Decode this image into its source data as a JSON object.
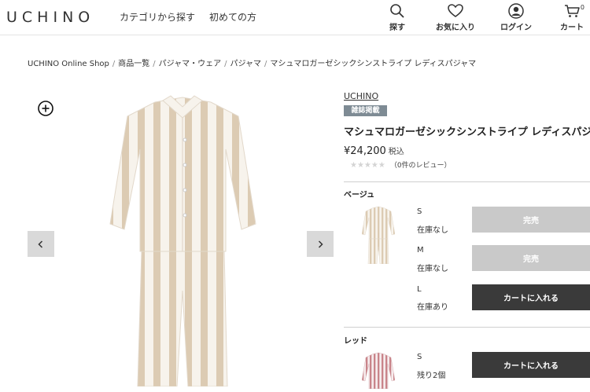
{
  "header": {
    "logo": "UCHINO",
    "nav": [
      "カテゴリから探す",
      "初めての方"
    ],
    "icons": [
      {
        "icon": "search-icon",
        "label": "探す"
      },
      {
        "icon": "heart-icon",
        "label": "お気に入り"
      },
      {
        "icon": "user-icon",
        "label": "ログイン"
      },
      {
        "icon": "cart-icon",
        "label": "カート",
        "count": "0"
      }
    ]
  },
  "breadcrumb": [
    "UCHINO Online Shop",
    "商品一覧",
    "パジャマ・ウェア",
    "パジャマ",
    "マシュマロガーゼシックシンストライプ レディスパジャマ"
  ],
  "product": {
    "brand": "UCHINO",
    "badge": "雑誌掲載",
    "title": "マシュマロガーゼシックシンストライプ レディスパジャマ",
    "price": "¥24,200",
    "tax_label": "税込",
    "stars": "★★★★★",
    "review_text": "（0件のレビュー）"
  },
  "colors": [
    {
      "name": "ベージュ",
      "stripe_color": "#d8c7ae",
      "sizes": [
        {
          "size": "S",
          "stock": "在庫なし",
          "button": "完売",
          "state": "soldout"
        },
        {
          "size": "M",
          "stock": "在庫なし",
          "button": "完売",
          "state": "soldout"
        },
        {
          "size": "L",
          "stock": "在庫あり",
          "button": "カートに入れる",
          "state": "available"
        }
      ]
    },
    {
      "name": "レッド",
      "stripe_color": "#c9848a",
      "sizes": [
        {
          "size": "S",
          "stock": "残り2個",
          "button": "カートに入れる",
          "state": "available"
        }
      ]
    }
  ],
  "theme": {
    "soldout": "#c9c9c9",
    "cart": "#3a3a3a",
    "badge": "#7e8b94"
  }
}
